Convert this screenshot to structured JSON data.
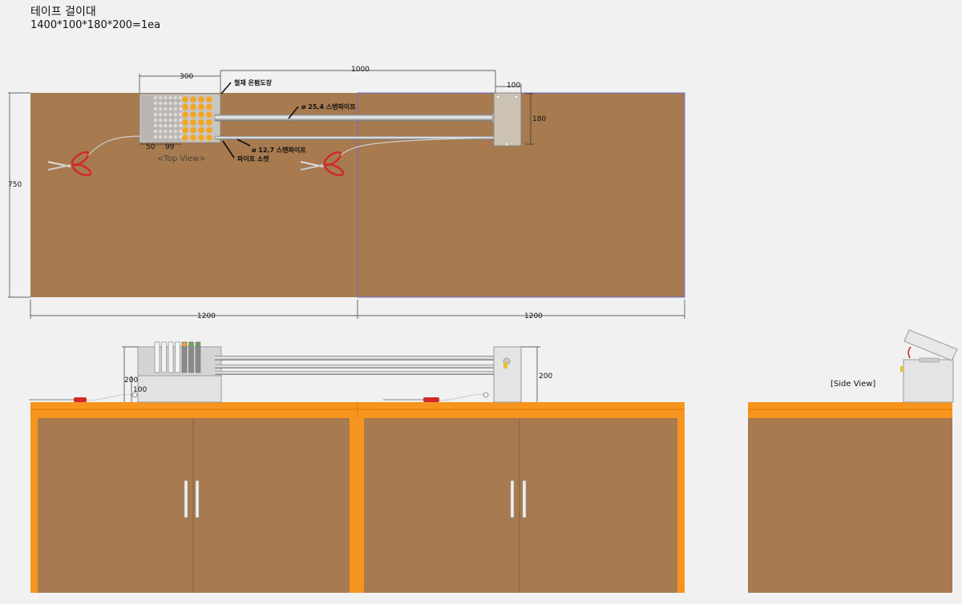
{
  "header": {
    "title": "테이프 걸이대",
    "spec": "1400*100*180*200=1ea"
  },
  "top_view": {
    "caption": "<Top View>",
    "dims": {
      "d300": "300",
      "d1000": "1000",
      "d100": "100",
      "d180": "180",
      "d750": "750",
      "d50": "50",
      "d99": "99",
      "d1200a": "1200",
      "d1200b": "1200"
    },
    "labels": {
      "finish": "철재 은펌도장",
      "pipe_large": "ø 25,4 스텐파이프",
      "pipe_small": "ø 12,7 스텐파이프",
      "socket": "파이프 소켓"
    }
  },
  "front_view": {
    "dims": {
      "d200a": "200",
      "d100": "100",
      "d200b": "200"
    }
  },
  "side_view": {
    "caption": "[Side View]"
  },
  "colors": {
    "wood": "#a77a4f",
    "orange": "#f7941d",
    "steel": "#cfcfcf",
    "dot": "#f5a623"
  }
}
